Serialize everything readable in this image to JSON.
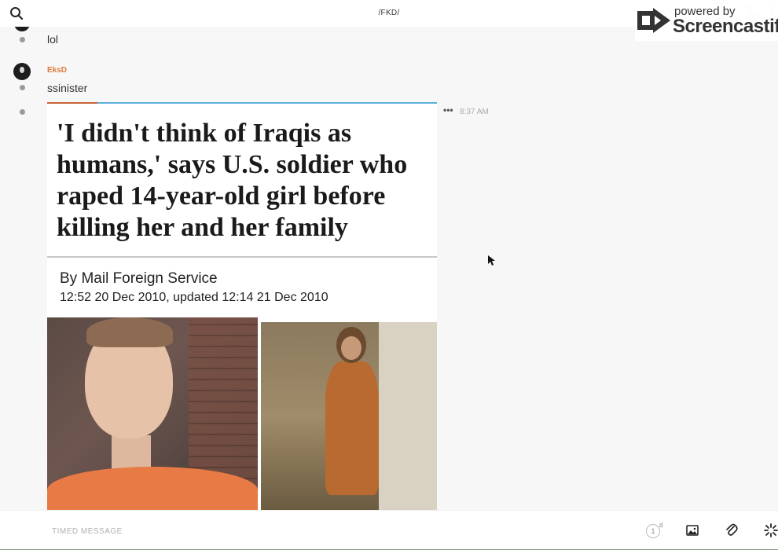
{
  "header": {
    "channel_title": "/FKD/",
    "search_icon": "search-icon",
    "phone_icon": "phone-icon",
    "info_icon": "info-icon"
  },
  "watermark": {
    "powered": "powered by",
    "brand": "Screencastify"
  },
  "messages": [
    {
      "text": "lol"
    },
    {
      "username": "EksD",
      "text": "ssinister"
    }
  ],
  "image_post": {
    "headline": "'I didn't think of Iraqis as humans,' says U.S. soldier who raped 14-year-old girl before killing her and her family",
    "byline": "By Mail Foreign Service",
    "dateline": "12:52 20 Dec 2010, updated 12:14 21 Dec 2010",
    "actions_label": "•••",
    "timestamp": "8:37 AM"
  },
  "composer": {
    "placeholder": "TIMED MESSAGE",
    "timer_value": "1",
    "timer_unit": "d",
    "image_icon": "image-icon",
    "attach_icon": "paperclip-icon",
    "send_icon": "sparkle-icon"
  },
  "colors": {
    "username": "#e07a3c",
    "progress": "#5ab0d8",
    "progress_start": "#c9633a",
    "background": "#f7f7f7"
  }
}
